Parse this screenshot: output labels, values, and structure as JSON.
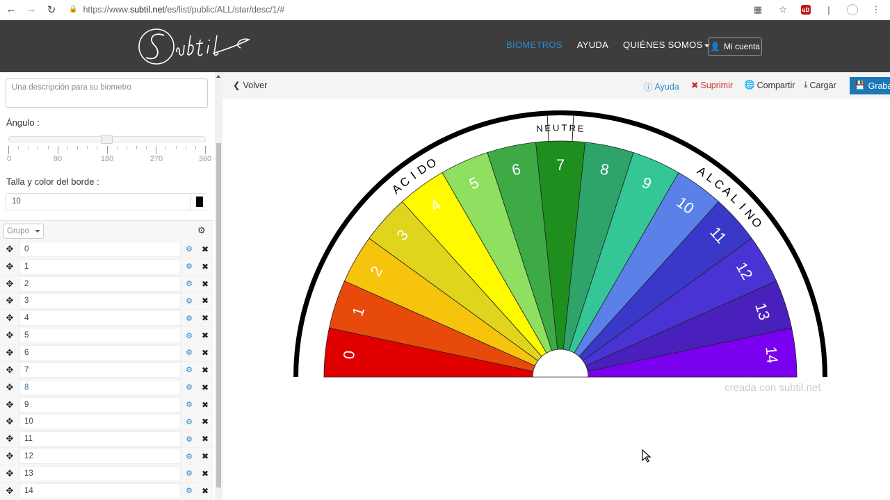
{
  "browser": {
    "url_prefix": "https://www.",
    "url_domain": "subtil.net",
    "url_path": "/es/list/public/ALL/star/desc/1/#"
  },
  "header": {
    "logo_text": "Subtil",
    "nav": [
      "BIOMETROS",
      "AYUDA",
      "QUIÉNES SOMOS"
    ],
    "account": "Mi cuenta"
  },
  "sidebar": {
    "description_placeholder": "Una descripción para su biometro",
    "angle_label": "Ángulo :",
    "angle_ticks": [
      "0",
      "90",
      "180",
      "270",
      "360"
    ],
    "angle_value": 180,
    "border_label": "Talla y color del borde :",
    "border_size": "10",
    "border_color": "#000000",
    "group_button": "Grupo",
    "items": [
      "0",
      "1",
      "2",
      "3",
      "4",
      "5",
      "6",
      "7",
      "8",
      "9",
      "10",
      "11",
      "12",
      "13",
      "14"
    ]
  },
  "toolbar": {
    "back": "Volver",
    "help": "Ayuda",
    "delete": "Suprimir",
    "share": "Compartir",
    "load": "Cargar",
    "save": "Grabar"
  },
  "biometer": {
    "sectors": [
      {
        "label": "0",
        "color": "#e10000"
      },
      {
        "label": "1",
        "color": "#e84a0c"
      },
      {
        "label": "2",
        "color": "#f6c30d"
      },
      {
        "label": "3",
        "color": "#e0d51c"
      },
      {
        "label": "4",
        "color": "#fffa00"
      },
      {
        "label": "5",
        "color": "#8fe060"
      },
      {
        "label": "6",
        "color": "#3daa45"
      },
      {
        "label": "7",
        "color": "#1e8f1e"
      },
      {
        "label": "8",
        "color": "#2ea36a"
      },
      {
        "label": "9",
        "color": "#34c696"
      },
      {
        "label": "10",
        "color": "#5b80e8"
      },
      {
        "label": "11",
        "color": "#3a38c8"
      },
      {
        "label": "12",
        "color": "#4a33d4"
      },
      {
        "label": "13",
        "color": "#4a20bc"
      },
      {
        "label": "14",
        "color": "#7a00f0"
      }
    ],
    "groups": [
      "ACIDO",
      "NEUTRE",
      "ALCALINO"
    ],
    "credit": "creada con subtil.net"
  }
}
